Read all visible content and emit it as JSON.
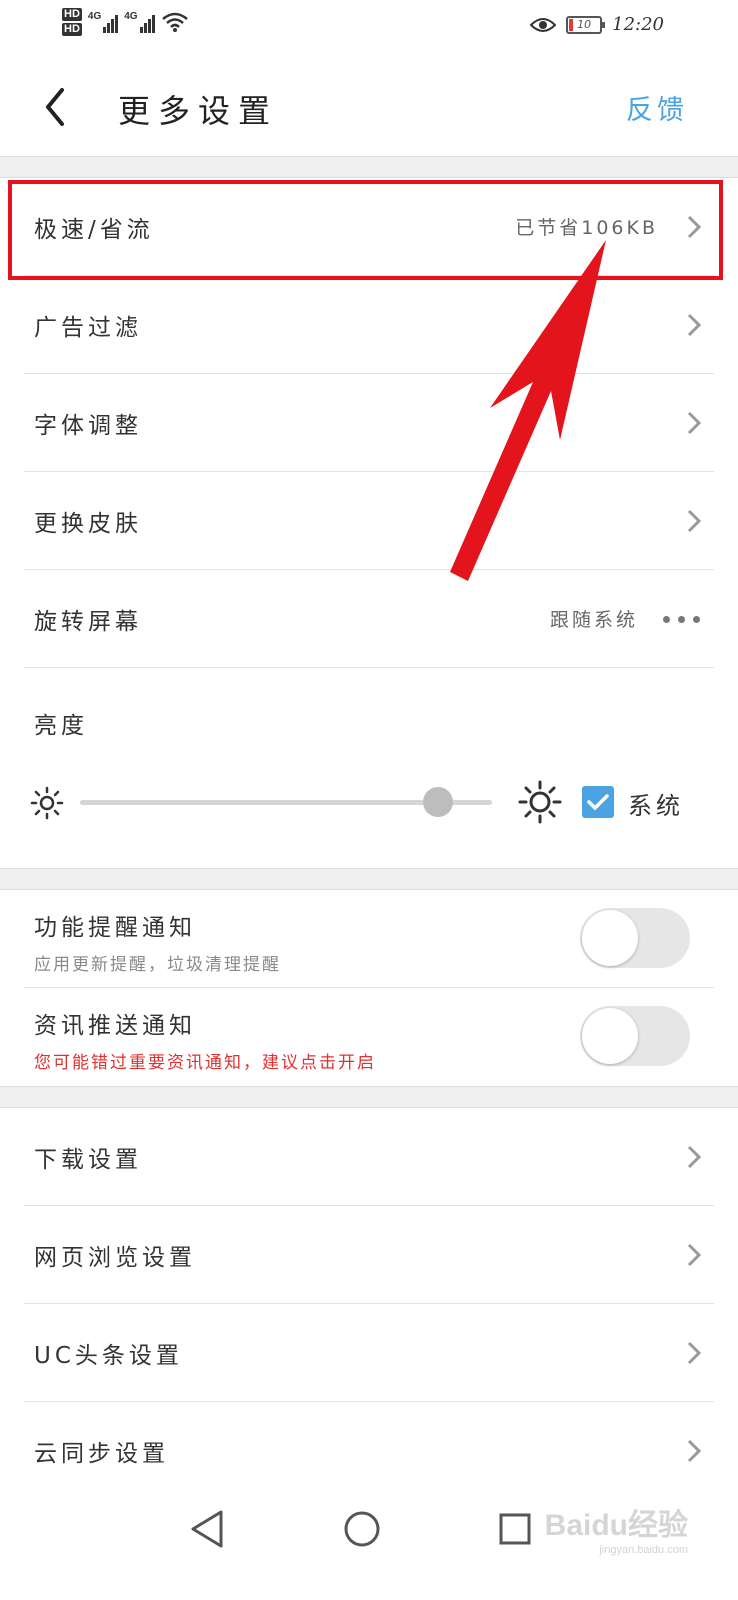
{
  "status_bar": {
    "sim1_badge": "HD",
    "sim2_badge": "HD",
    "net1_label": "4G",
    "net2_label": "4G",
    "battery_level": "10",
    "time": "12:20",
    "icons": [
      "signal-icon",
      "wifi-icon",
      "eye-icon",
      "battery-icon"
    ]
  },
  "header": {
    "back_icon": "chevron-left-icon",
    "title": "更多设置",
    "feedback": "反馈"
  },
  "colors": {
    "accent": "#4ba3e3",
    "highlight": "#e3141b",
    "warning_text": "#e03030",
    "separator": "#f0f0f0"
  },
  "settings_group_1": [
    {
      "label": "极速/省流",
      "value": "已节省106KB",
      "control": "chevron"
    },
    {
      "label": "广告过滤",
      "value": "",
      "control": "chevron"
    },
    {
      "label": "字体调整",
      "value": "",
      "control": "chevron"
    },
    {
      "label": "更换皮肤",
      "value": "",
      "control": "chevron"
    },
    {
      "label": "旋转屏幕",
      "value": "跟随系统",
      "control": "more-dots"
    }
  ],
  "brightness": {
    "title": "亮度",
    "level": 0.87,
    "follow_system": true,
    "system_label": "系统"
  },
  "notifications": [
    {
      "title": "功能提醒通知",
      "subtitle": "应用更新提醒，垃圾清理提醒",
      "enabled": false,
      "warning": false
    },
    {
      "title": "资讯推送通知",
      "subtitle": "您可能错过重要资讯通知，建议点击开启",
      "enabled": false,
      "warning": true
    }
  ],
  "settings_group_2": [
    {
      "label": "下载设置"
    },
    {
      "label": "网页浏览设置"
    },
    {
      "label": "UC头条设置"
    },
    {
      "label": "云同步设置"
    }
  ],
  "nav_bar": {
    "icons": [
      "back-triangle-icon",
      "home-circle-icon",
      "recents-square-icon"
    ]
  },
  "watermark": {
    "main": "Baidu经验",
    "sub": "jingyan.baidu.com"
  }
}
